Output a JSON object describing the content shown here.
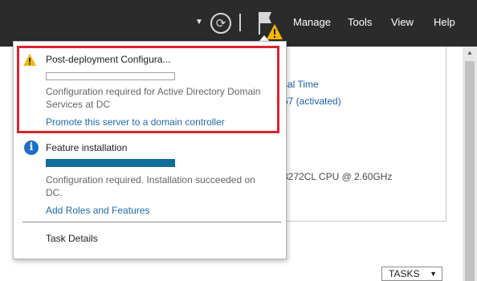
{
  "topbar": {
    "menu": [
      "Manage",
      "Tools",
      "View",
      "Help"
    ],
    "icons": [
      "dropdown-caret",
      "refresh-icon",
      "notifications-flag-icon"
    ]
  },
  "background": {
    "links": [
      "sal Time",
      "67 (activated)"
    ],
    "text": "8272CL CPU @ 2.60GHz",
    "tasks_button": "TASKS"
  },
  "notifications": [
    {
      "icon": "warning-icon",
      "title": "Post-deployment Configura...",
      "progress": 0,
      "description": "Configuration required for Active Directory Domain Services at DC",
      "link": "Promote this server to a domain controller",
      "highlighted": true
    },
    {
      "icon": "info-icon",
      "title": "Feature installation",
      "progress": 1.0,
      "description": "Configuration required. Installation succeeded on DC.",
      "link": "Add Roles and Features",
      "highlighted": false
    }
  ],
  "footer": {
    "task_details": "Task Details"
  },
  "colors": {
    "topbar": "#2b2b2b",
    "highlight": "#d9242e",
    "progress_fill": "#0f6e9a",
    "link": "#1f6aa8",
    "warning": "#f5b800",
    "info": "#1a6fc4"
  }
}
